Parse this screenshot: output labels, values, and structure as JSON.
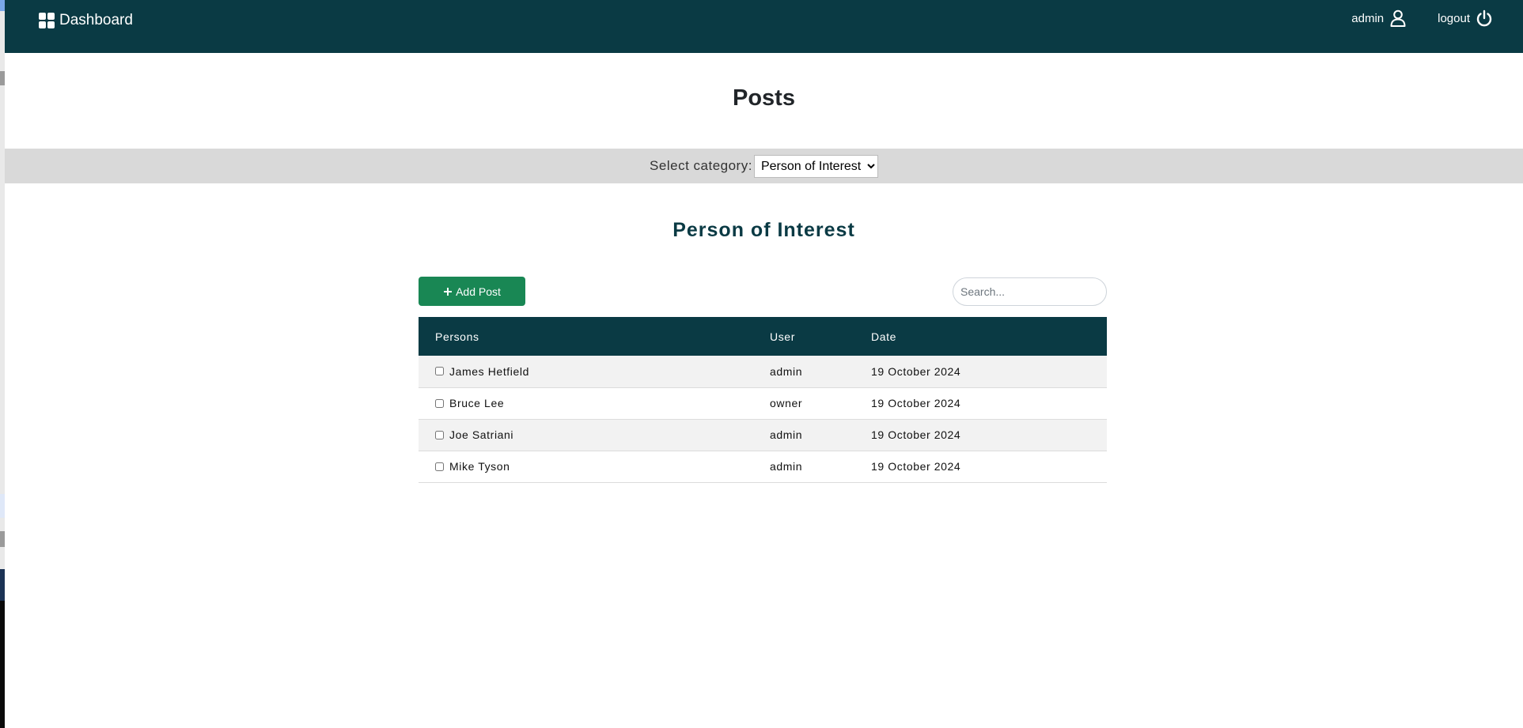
{
  "topbar": {
    "brand": "Dashboard",
    "user_label": "admin",
    "logout_label": "logout",
    "background": "#0a3a44"
  },
  "page": {
    "title": "Posts"
  },
  "category": {
    "label": "Select category:",
    "selected": "Person of Interest"
  },
  "section": {
    "title": "Person of Interest"
  },
  "toolbar": {
    "add_label": "Add Post",
    "add_color": "#198754",
    "search_placeholder": "Search..."
  },
  "table": {
    "headers": [
      "Persons",
      "User",
      "Date"
    ],
    "rows": [
      {
        "person": "James Hetfield",
        "user": "admin",
        "date": "19 October 2024"
      },
      {
        "person": "Bruce Lee",
        "user": "owner",
        "date": "19 October 2024"
      },
      {
        "person": "Joe Satriani",
        "user": "admin",
        "date": "19 October 2024"
      },
      {
        "person": "Mike Tyson",
        "user": "admin",
        "date": "19 October 2024"
      }
    ]
  }
}
